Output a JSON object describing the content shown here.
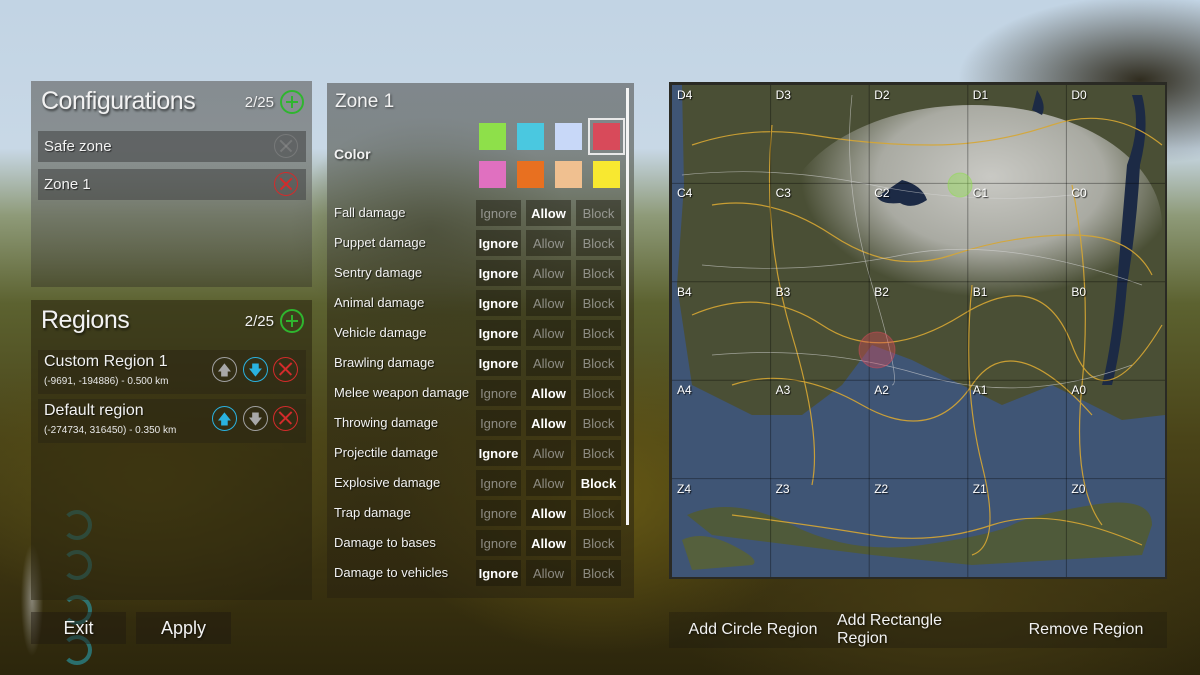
{
  "configurations": {
    "title": "Configurations",
    "count": "2/25",
    "add_icon": "plus-circle-icon",
    "items": [
      {
        "label": "Safe zone",
        "deletable": false
      },
      {
        "label": "Zone 1",
        "deletable": true
      }
    ]
  },
  "regions": {
    "title": "Regions",
    "count": "2/25",
    "items": [
      {
        "name": "Custom Region 1",
        "details": "(-9691, -194886) - 0.500 km",
        "up_active": false,
        "down_active": true
      },
      {
        "name": "Default region",
        "details": "(-274734, 316450) - 0.350 km",
        "up_active": true,
        "down_active": false
      }
    ]
  },
  "footer": {
    "exit_label": "Exit",
    "apply_label": "Apply"
  },
  "zone": {
    "title": "Zone 1",
    "color_label": "Color",
    "colors": [
      "#8ee04a",
      "#4ac8e0",
      "#c8d8f8",
      "#d84a5a",
      "#e070c0",
      "#e87020",
      "#f0c090",
      "#f8e830"
    ],
    "selected_color_index": 3,
    "options": [
      "Ignore",
      "Allow",
      "Block"
    ],
    "damage_rules": [
      {
        "label": "Fall damage",
        "value": "Allow"
      },
      {
        "label": "Puppet damage",
        "value": "Ignore"
      },
      {
        "label": "Sentry damage",
        "value": "Ignore"
      },
      {
        "label": "Animal damage",
        "value": "Ignore"
      },
      {
        "label": "Vehicle damage",
        "value": "Ignore"
      },
      {
        "label": "Brawling damage",
        "value": "Ignore"
      },
      {
        "label": "Melee weapon damage",
        "value": "Allow"
      },
      {
        "label": "Throwing damage",
        "value": "Allow"
      },
      {
        "label": "Projectile damage",
        "value": "Ignore"
      },
      {
        "label": "Explosive damage",
        "value": "Block"
      },
      {
        "label": "Trap damage",
        "value": "Allow"
      },
      {
        "label": "Damage to bases",
        "value": "Allow"
      },
      {
        "label": "Damage to vehicles",
        "value": "Ignore"
      }
    ]
  },
  "map": {
    "columns": [
      "4",
      "3",
      "2",
      "1",
      "0"
    ],
    "rows": [
      "D",
      "C",
      "B",
      "A",
      "Z"
    ],
    "regions": [
      {
        "name": "Custom Region 1",
        "color": "#d84a5a"
      },
      {
        "name": "Default region",
        "color": "#8ee04a"
      }
    ]
  },
  "map_actions": {
    "add_circle_label": "Add Circle Region",
    "add_rectangle_label": "Add Rectangle Region",
    "remove_label": "Remove Region"
  }
}
